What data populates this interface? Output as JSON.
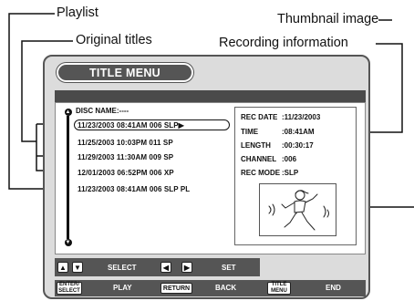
{
  "callouts": {
    "playlist": "Playlist",
    "original_titles": "Original titles",
    "thumbnail_image": "Thumbnail image",
    "recording_information": "Recording information"
  },
  "menu": {
    "title": "TITLE MENU",
    "disc_name": "DISC NAME:----",
    "titles": [
      "11/23/2003 08:41AM 006 SLP▶",
      "11/25/2003 10:03PM 011 SP",
      "11/29/2003 11:30AM 009 SP",
      "12/01/2003 06:52PM 006 XP",
      "11/23/2003 08:41AM 006 SLP PL"
    ]
  },
  "info": [
    {
      "key": "REC DATE",
      "value": ":11/23/2003"
    },
    {
      "key": "TIME",
      "value": ":08:41AM"
    },
    {
      "key": "LENGTH",
      "value": ":00:30:17"
    },
    {
      "key": "CHANNEL",
      "value": ":006"
    },
    {
      "key": "REC MODE",
      "value": ":SLP"
    }
  ],
  "controls": {
    "select_label": "SELECT",
    "set_label": "SET",
    "play_key": "ENTER/\nSELECT",
    "play_label": "PLAY",
    "return_key": "RETURN",
    "back_label": "BACK",
    "title_menu_key": "TITLE\nMENU",
    "end_label": "END"
  }
}
